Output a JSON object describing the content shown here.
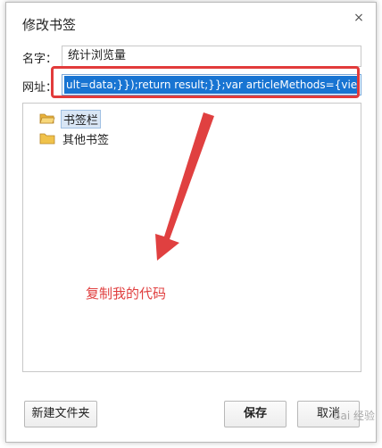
{
  "dialog": {
    "title": "修改书签",
    "close_symbol": "×"
  },
  "form": {
    "name_label": "名字：",
    "name_value": "统计浏览量",
    "url_label": "网址：",
    "url_value": "ult=data;}});return result;}};var articleMethods={views:func"
  },
  "tree": {
    "items": [
      {
        "label": "书签栏",
        "icon": "folder-open-icon",
        "selected": true
      },
      {
        "label": "其他书签",
        "icon": "folder-icon",
        "selected": false
      }
    ]
  },
  "annotation": {
    "text": "复制我的代码",
    "color": "#e04040"
  },
  "buttons": {
    "new_folder": "新建文件夹",
    "save": "保存",
    "cancel": "取消"
  },
  "watermark": "Bai 经验",
  "colors": {
    "selection": "#1874d2",
    "highlight_border": "#e23b3b",
    "folder": "#f0c24b"
  }
}
